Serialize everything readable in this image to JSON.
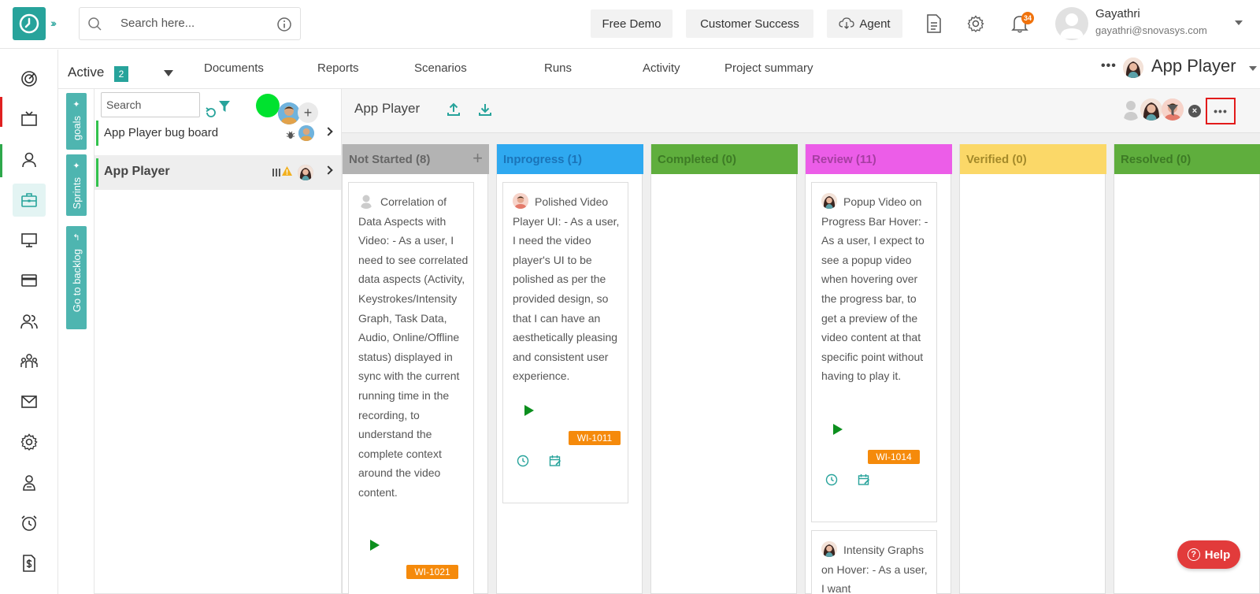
{
  "topbar": {
    "search_placeholder": "Search here...",
    "free_demo": "Free Demo",
    "customer_success": "Customer Success",
    "agent": "Agent",
    "notification_count": "34",
    "user_name": "Gayathri",
    "user_email": "gayathri@snovasys.com"
  },
  "subheader": {
    "active_label": "Active",
    "active_count": "2",
    "tabs": [
      "Documents",
      "Reports",
      "Scenarios",
      "Runs",
      "Activity",
      "Project summary"
    ],
    "more": "•••",
    "project_name": "App Player"
  },
  "vertical_tabs": [
    "goals",
    "Sprints",
    "Go to backlog"
  ],
  "board_panel": {
    "search_placeholder": "Search",
    "plus": "+",
    "boards": [
      {
        "label": "App Player bug board"
      },
      {
        "label": "App Player"
      }
    ]
  },
  "kanban": {
    "title": "App Player",
    "more": "•••",
    "close": "×",
    "columns": [
      {
        "label": "Not Started (8)",
        "color": "#b3b3b3",
        "text_color": "#666666",
        "plus": "+"
      },
      {
        "label": "Inprogress (1)",
        "color": "#2fa9f0",
        "text_color": "#1b74b8"
      },
      {
        "label": "Completed (0)",
        "color": "#5fae3d",
        "text_color": "#3d7b25"
      },
      {
        "label": "Review (11)",
        "color": "#ec5de8",
        "text_color": "#a63ea2"
      },
      {
        "label": "Verified (0)",
        "color": "#fbd868",
        "text_color": "#a48a2a"
      },
      {
        "label": "Resolved (0)",
        "color": "#5fae3d",
        "text_color": "#3d7b25"
      }
    ],
    "cards": [
      {
        "text": "Correlation of Data Aspects with Video: - As a user, I need to see correlated data aspects (Activity, Keystrokes/Intensity Graph, Task Data, Audio, Online/Offline status) displayed in sync with the current running time in the recording, to understand the complete context around the video content.",
        "id": "WI-1021"
      },
      {
        "text": "Polished Video Player UI: - As a user, I need the video player's UI to be polished as per the provided design, so that I can have an aesthetically pleasing and consistent user experience.",
        "id": "WI-1011"
      },
      {
        "text": "Popup Video on Progress Bar Hover: - As a user, I expect to see a popup video when hovering over the progress bar, to get a preview of the video content at that specific point without having to play it.",
        "id": "WI-1014"
      },
      {
        "text": "Intensity Graphs on Hover: - As a user, I want"
      }
    ]
  },
  "help": {
    "label": "Help",
    "q": "?"
  },
  "colors": {
    "accent": "#27a39b",
    "badge_orange": "#f58a0b",
    "highlight_red": "#e21b1b",
    "help_red": "#e23b3b"
  }
}
